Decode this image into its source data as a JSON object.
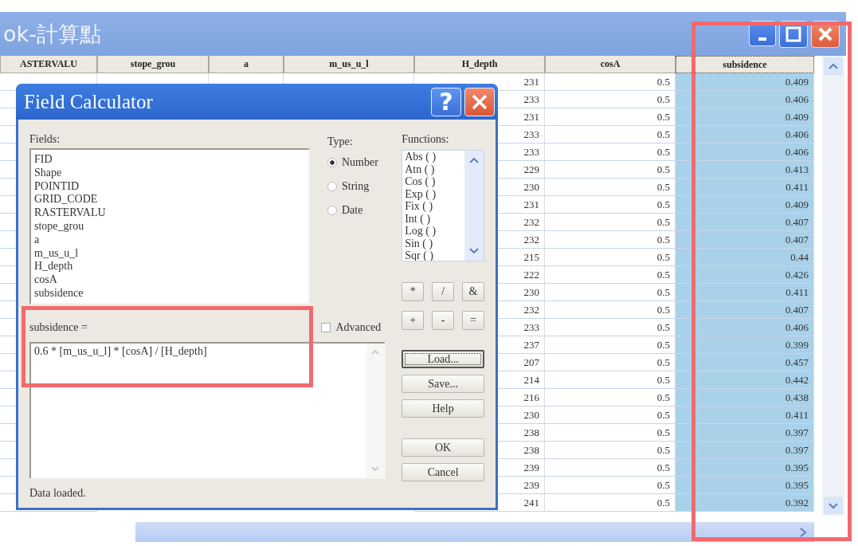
{
  "table_window": {
    "title": "ok-計算點",
    "columns": [
      {
        "label": "ASTERVALU",
        "selected": false,
        "highlighted": false
      },
      {
        "label": "stope_grou",
        "selected": false,
        "highlighted": false
      },
      {
        "label": "a",
        "selected": false,
        "highlighted": false
      },
      {
        "label": "m_us_u_l",
        "selected": false,
        "highlighted": false
      },
      {
        "label": "H_depth",
        "selected": false,
        "highlighted": false
      },
      {
        "label": "cosA",
        "selected": false,
        "highlighted": false
      },
      {
        "label": "subsidence",
        "selected": true,
        "highlighted": true
      }
    ],
    "rows": [
      {
        "cells": [
          "231",
          "0.5",
          "0.409"
        ]
      },
      {
        "cells": [
          "233",
          "0.5",
          "0.406"
        ]
      },
      {
        "cells": [
          "231",
          "0.5",
          "0.409"
        ]
      },
      {
        "cells": [
          "233",
          "0.5",
          "0.406"
        ]
      },
      {
        "cells": [
          "233",
          "0.5",
          "0.406"
        ]
      },
      {
        "cells": [
          "229",
          "0.5",
          "0.413"
        ]
      },
      {
        "cells": [
          "230",
          "0.5",
          "0.411"
        ]
      },
      {
        "cells": [
          "231",
          "0.5",
          "0.409"
        ]
      },
      {
        "cells": [
          "232",
          "0.5",
          "0.407"
        ]
      },
      {
        "cells": [
          "232",
          "0.5",
          "0.407"
        ]
      },
      {
        "cells": [
          "215",
          "0.5",
          "0.44"
        ]
      },
      {
        "cells": [
          "222",
          "0.5",
          "0.426"
        ]
      },
      {
        "cells": [
          "230",
          "0.5",
          "0.411"
        ]
      },
      {
        "cells": [
          "232",
          "0.5",
          "0.407"
        ]
      },
      {
        "cells": [
          "233",
          "0.5",
          "0.406"
        ]
      },
      {
        "cells": [
          "237",
          "0.5",
          "0.399"
        ]
      },
      {
        "cells": [
          "207",
          "0.5",
          "0.457"
        ]
      },
      {
        "cells": [
          "214",
          "0.5",
          "0.442"
        ]
      },
      {
        "cells": [
          "216",
          "0.5",
          "0.438"
        ]
      },
      {
        "cells": [
          "230",
          "0.5",
          "0.411"
        ]
      },
      {
        "cells": [
          "238",
          "0.5",
          "0.397"
        ]
      },
      {
        "cells": [
          "238",
          "0.5",
          "0.397"
        ]
      },
      {
        "cells": [
          "239",
          "0.5",
          "0.395"
        ]
      },
      {
        "cells": [
          "239",
          "0.5",
          "0.395"
        ]
      },
      {
        "cells": [
          "241",
          "0.5",
          "0.392"
        ]
      }
    ]
  },
  "dialog": {
    "title": "Field Calculator",
    "help_button": "?",
    "fields_label": "Fields:",
    "fields": [
      "FID",
      "Shape",
      "POINTID",
      "GRID_CODE",
      "RASTERVALU",
      "stope_grou",
      "a",
      "m_us_u_l",
      "H_depth",
      "cosA",
      "subsidence"
    ],
    "type_label": "Type:",
    "types": [
      {
        "label": "Number",
        "selected": true
      },
      {
        "label": "String",
        "selected": false
      },
      {
        "label": "Date",
        "selected": false
      }
    ],
    "functions_label": "Functions:",
    "functions": [
      "Abs ( )",
      "Atn ( )",
      "Cos ( )",
      "Exp ( )",
      "Fix ( )",
      "Int ( )",
      "Log ( )",
      "Sin ( )",
      "Sqr ( )"
    ],
    "operators": [
      "*",
      "/",
      "&",
      "+",
      "-",
      "="
    ],
    "expression_label": "subsidence =",
    "advanced": {
      "label": "Advanced",
      "checked": false
    },
    "expression": "0.6 * [m_us_u_l] * [cosA] / [H_depth]",
    "expression_highlighted": true,
    "buttons": [
      {
        "label": "Load...",
        "kind": "file",
        "focused": true
      },
      {
        "label": "Save...",
        "kind": "file",
        "focused": false
      },
      {
        "label": "Help",
        "kind": "file",
        "focused": false
      },
      {
        "label": "OK",
        "kind": "action",
        "focused": false
      },
      {
        "label": "Cancel",
        "kind": "action",
        "focused": false
      }
    ],
    "status": "Data loaded."
  }
}
